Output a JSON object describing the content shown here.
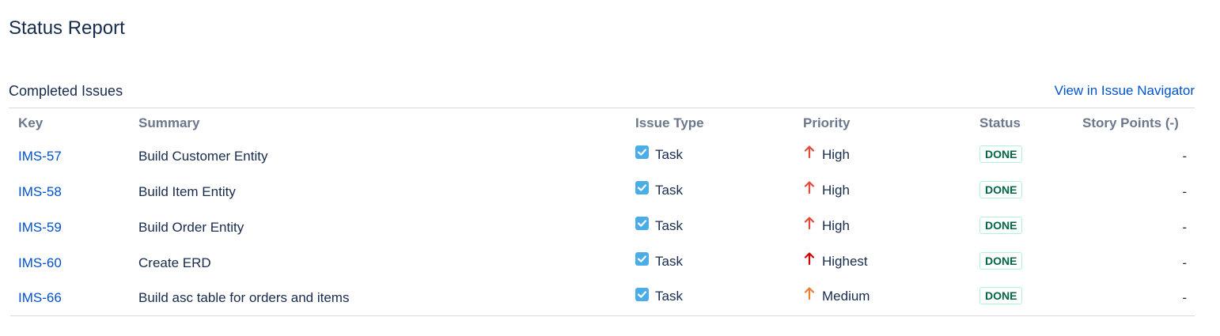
{
  "page": {
    "title": "Status Report"
  },
  "section": {
    "title": "Completed Issues",
    "navigator_link": "View in Issue Navigator"
  },
  "table": {
    "headers": [
      "Key",
      "Summary",
      "Issue Type",
      "Priority",
      "Status",
      "Story Points (-)"
    ],
    "rows": [
      {
        "key": "IMS-57",
        "summary": "Build Customer Entity",
        "type": "Task",
        "type_icon": "task-checkbox-icon",
        "priority": "High",
        "priority_icon": "arrow-up-icon",
        "priority_color": "#e5493a",
        "status": "DONE",
        "points": "-"
      },
      {
        "key": "IMS-58",
        "summary": "Build Item Entity",
        "type": "Task",
        "type_icon": "task-checkbox-icon",
        "priority": "High",
        "priority_icon": "arrow-up-icon",
        "priority_color": "#e5493a",
        "status": "DONE",
        "points": "-"
      },
      {
        "key": "IMS-59",
        "summary": "Build Order Entity",
        "type": "Task",
        "type_icon": "task-checkbox-icon",
        "priority": "High",
        "priority_icon": "arrow-up-icon",
        "priority_color": "#e5493a",
        "status": "DONE",
        "points": "-"
      },
      {
        "key": "IMS-60",
        "summary": "Create ERD",
        "type": "Task",
        "type_icon": "task-checkbox-icon",
        "priority": "Highest",
        "priority_icon": "arrow-up-icon",
        "priority_color": "#ce0000",
        "status": "DONE",
        "points": "-"
      },
      {
        "key": "IMS-66",
        "summary": "Build asc table for orders and items",
        "type": "Task",
        "type_icon": "task-checkbox-icon",
        "priority": "Medium",
        "priority_icon": "arrow-up-icon",
        "priority_color": "#e97f33",
        "status": "DONE",
        "points": "-"
      }
    ]
  },
  "colors": {
    "link": "#0052cc",
    "heading_text": "#172b4d",
    "column_header_text": "#6b778c",
    "task_icon_bg": "#4bade8",
    "done_text": "#006644",
    "done_border": "#abf5d1",
    "divider": "#d6d9de"
  }
}
